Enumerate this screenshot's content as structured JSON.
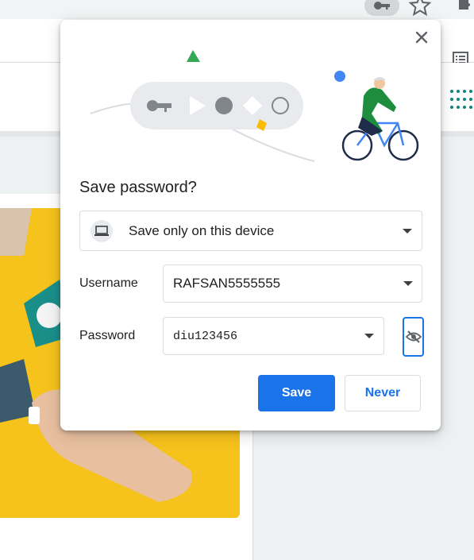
{
  "dialog": {
    "title": "Save password?",
    "destination": {
      "label": "Save only on this device",
      "icon": "laptop-icon"
    },
    "username": {
      "label": "Username",
      "value": "RAFSAN5555555"
    },
    "password": {
      "label": "Password",
      "value": "diu123456"
    },
    "save_label": "Save",
    "never_label": "Never"
  },
  "colors": {
    "accent": "#1a73e8",
    "hero": "#f6c21c"
  },
  "icons": {
    "close": "close-icon",
    "eye": "eye-off-icon",
    "key": "key-icon",
    "star": "star-icon",
    "extensions": "puzzle-icon",
    "reading_list": "reading-list-icon"
  }
}
